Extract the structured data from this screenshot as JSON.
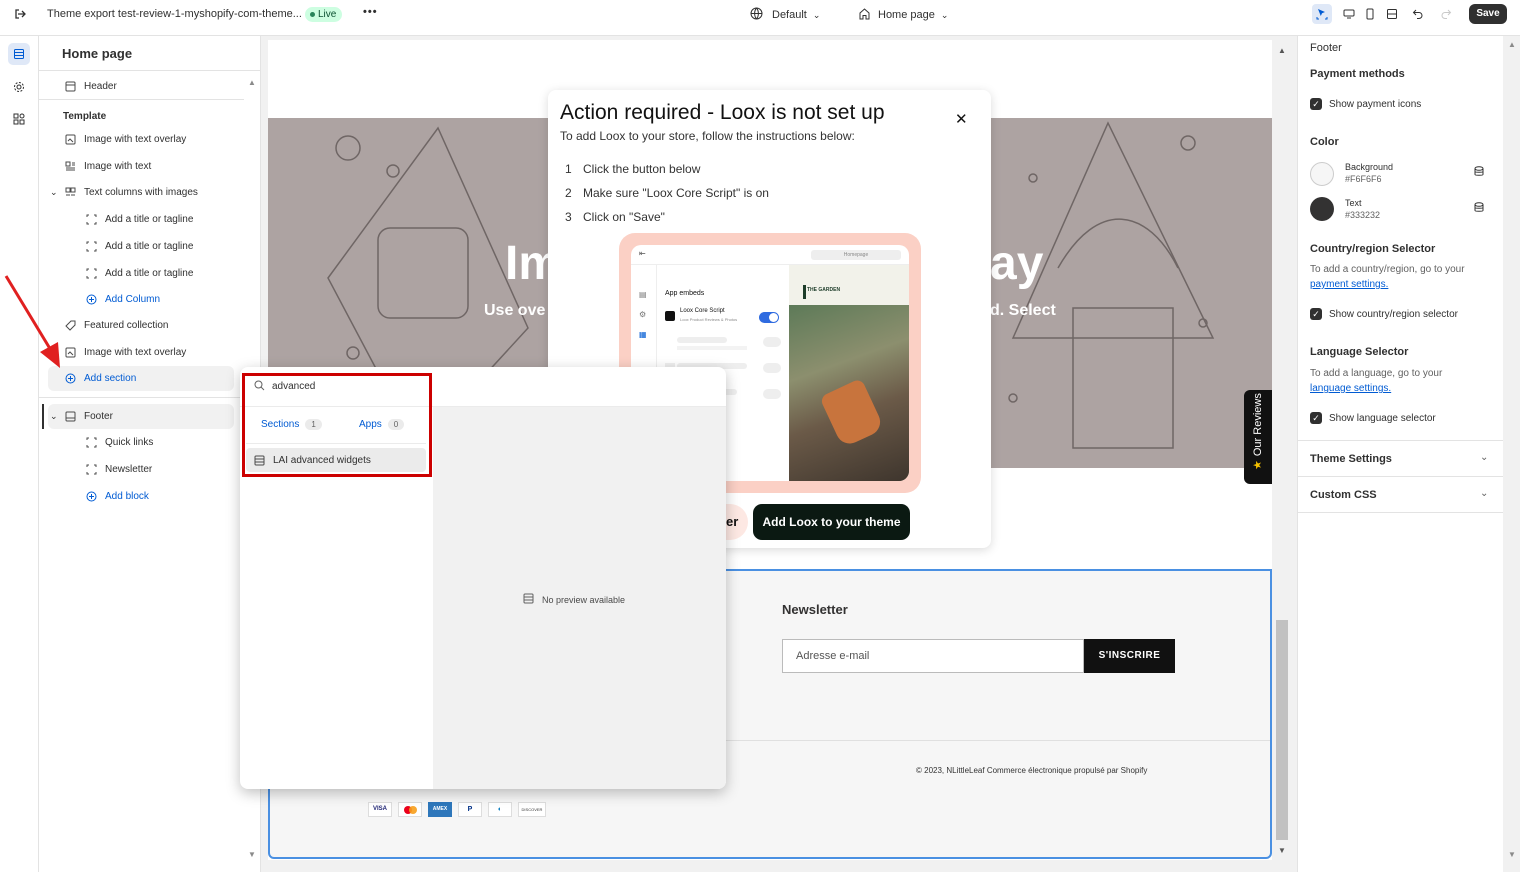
{
  "topbar": {
    "theme_name": "Theme export test-review-1-myshopify-com-theme...",
    "status_badge": "Live",
    "more_label": "•••",
    "device_select": "Default",
    "page_select": "Home page",
    "save_label": "Save"
  },
  "sidebar": {
    "title": "Home page",
    "header_item": "Header",
    "template_heading": "Template",
    "items": [
      "Image with text overlay",
      "Image with text",
      "Text columns with images",
      "Add a title or tagline",
      "Add a title or tagline",
      "Add a title or tagline",
      "Add Column",
      "Featured collection",
      "Image with text overlay",
      "Add section"
    ],
    "footer_item": "Footer",
    "footer_children": [
      "Quick links",
      "Newsletter",
      "Add block"
    ]
  },
  "popover": {
    "search_value": "advanced",
    "tabs": [
      {
        "label": "Sections",
        "count": "1"
      },
      {
        "label": "Apps",
        "count": "0"
      }
    ],
    "result": "LAI advanced widgets",
    "no_preview": "No preview available"
  },
  "modal": {
    "title": "Action required - Loox is not set up",
    "subtitle": "To add Loox to your store, follow the instructions below:",
    "steps": [
      {
        "num": "1",
        "text": "Click the button below"
      },
      {
        "num": "2",
        "text": "Make sure \"Loox Core Script\" is on"
      },
      {
        "num": "3",
        "text": "Click on \"Save\""
      }
    ],
    "close_label": "✕",
    "secondary_button_fragment": "er",
    "primary_button": "Add Loox to your theme",
    "illustration": {
      "homepage_label": "Homepage",
      "app_embeds": "App embeds",
      "script_name": "Loox Core Script",
      "script_sub": "Loox Product Reviews & Photos",
      "garden_logo": "THE GARDEN",
      "toggle_on": true
    }
  },
  "store": {
    "hero_title_left": "Im",
    "hero_title_right": "ay",
    "hero_sub_left": "Use ove",
    "hero_sub_right": "d. Select",
    "reviews_tab": "Our Reviews",
    "newsletter_title": "Newsletter",
    "email_placeholder": "Adresse e-mail",
    "subscribe_label": "S'INSCRIRE",
    "copyright": "© 2023, NLittleLeaf Commerce électronique propulsé par Shopify",
    "payment_icons": [
      "VISA",
      "mastercard",
      "AMEX",
      "P",
      "diners",
      "DISCOVER"
    ]
  },
  "right_panel": {
    "section_title": "Footer",
    "payment_heading": "Payment methods",
    "show_payment_icons": "Show payment icons",
    "color_heading": "Color",
    "background_label": "Background",
    "background_value": "#F6F6F6",
    "text_label": "Text",
    "text_value": "#333232",
    "country_heading": "Country/region Selector",
    "country_help": "To add a country/region, go to your",
    "country_link": "payment settings.",
    "show_country": "Show country/region selector",
    "language_heading": "Language Selector",
    "language_help": "To add a language, go to your",
    "language_link": "language settings.",
    "show_language": "Show language selector",
    "theme_settings": "Theme Settings",
    "custom_css": "Custom CSS"
  },
  "colors": {
    "accent_blue": "#005bd3",
    "highlight_red": "#cc0000",
    "hero_bg": "#ada3a2",
    "dark": "#303030",
    "live_green": "#cdfee1"
  }
}
